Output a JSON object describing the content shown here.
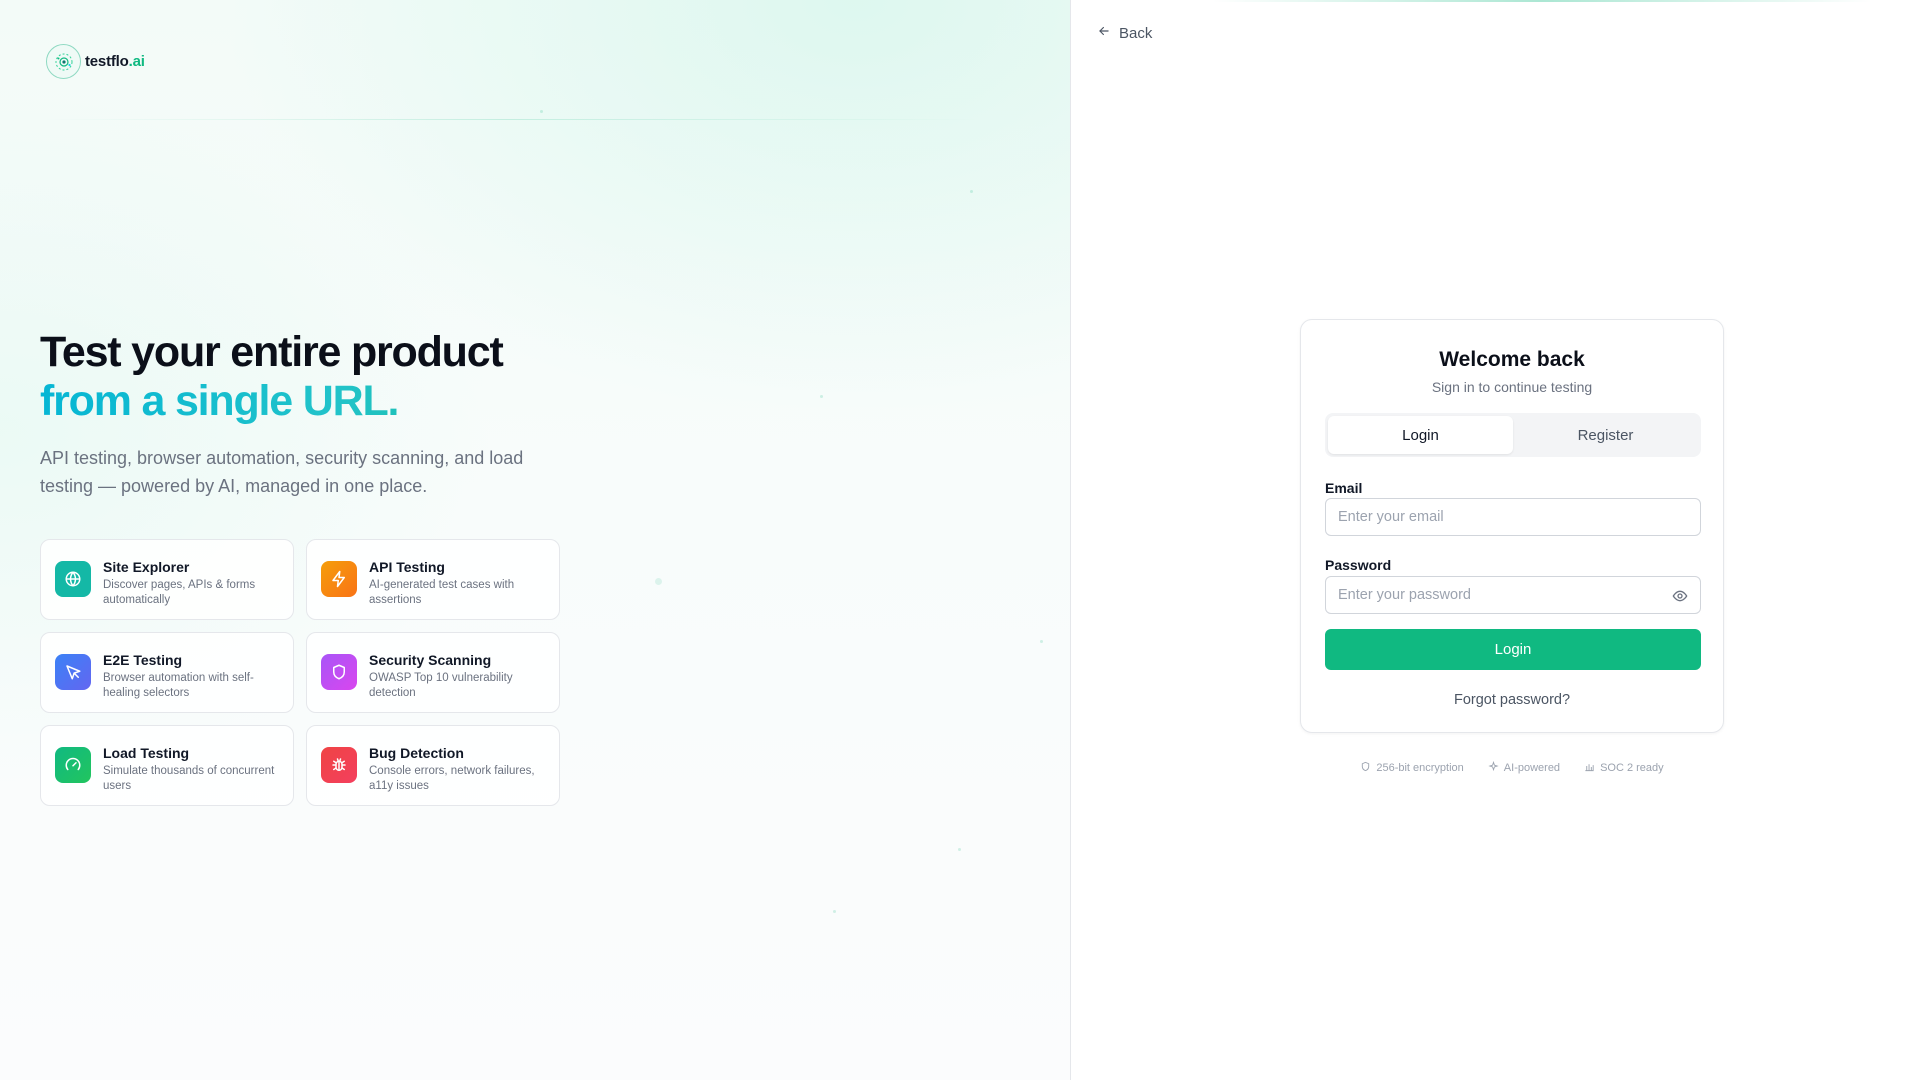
{
  "brand": {
    "name_main": "testflo",
    "name_suffix": ".ai",
    "accent_color": "#10b981"
  },
  "hero": {
    "title_line1": "Test your entire product",
    "title_line2": "from a single URL.",
    "description": "API testing, browser automation, security scanning, and load testing — powered by AI, managed in one place."
  },
  "features": [
    {
      "title": "Site Explorer",
      "description": "Discover pages, APIs & forms automatically",
      "icon": "globe-icon",
      "color": "#14b8a6"
    },
    {
      "title": "API Testing",
      "description": "AI-generated test cases with assertions",
      "icon": "lightning-icon",
      "color": "#f97316"
    },
    {
      "title": "E2E Testing",
      "description": "Browser automation with self-healing selectors",
      "icon": "cursor-icon",
      "color": "#6366f1"
    },
    {
      "title": "Security Scanning",
      "description": "OWASP Top 10 vulnerability detection",
      "icon": "shield-icon",
      "color": "#c026d3"
    },
    {
      "title": "Load Testing",
      "description": "Simulate thousands of concurrent users",
      "icon": "gauge-icon",
      "color": "#22c55e"
    },
    {
      "title": "Bug Detection",
      "description": "Console errors, network failures, a11y issues",
      "icon": "bug-icon",
      "color": "#f43f5e"
    }
  ],
  "nav": {
    "back_label": "Back"
  },
  "auth": {
    "title": "Welcome back",
    "subtitle": "Sign in to continue testing",
    "tabs": [
      {
        "label": "Login",
        "active": true
      },
      {
        "label": "Register",
        "active": false
      }
    ],
    "email_label": "Email",
    "email_value": "",
    "email_placeholder": "Enter your email",
    "password_label": "Password",
    "password_value": "",
    "password_placeholder": "Enter your password",
    "submit_label": "Login",
    "forgot_label": "Forgot password?"
  },
  "trust_badges": [
    {
      "label": "256-bit encryption",
      "icon": "shield-outline-icon"
    },
    {
      "label": "AI-powered",
      "icon": "sparkle-icon"
    },
    {
      "label": "SOC 2 ready",
      "icon": "bar-chart-icon"
    }
  ]
}
